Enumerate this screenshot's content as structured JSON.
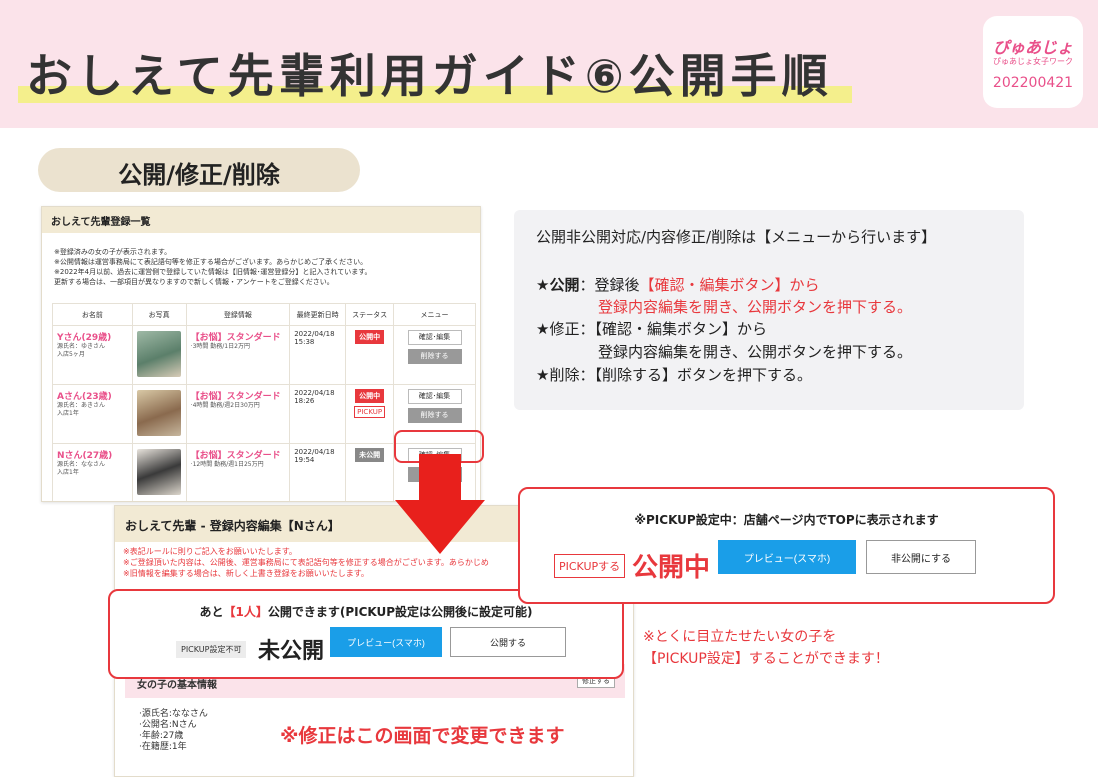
{
  "header": {
    "title": "おしえて先輩利用ガイド⑥公開手順",
    "logo_text": "ぴゅあじょ",
    "logo_sub": "ぴゅあじょ女子ワーク",
    "logo_date": "202200421"
  },
  "section_pill": "公開/修正/削除",
  "list_panel": {
    "title": "おしえて先輩登録一覧",
    "notes": [
      "※登録済みの女の子が表示されます。",
      "※公開情報は運営事務局にて表記語句等を修正する場合がございます。あらかじめご了承ください。",
      "※2022年4月以前、過去に運営側で登録していた情報は【旧情報･運営登録分】と記入されています。",
      "更新する場合は、一部項目が異なりますので新しく情報・アンケートをご登録ください。"
    ],
    "columns": [
      "お名前",
      "お写真",
      "登録情報",
      "最終更新日時",
      "ステータス",
      "メニュー"
    ],
    "rows": [
      {
        "name": "Yさん(29歳)",
        "genji": "源氏名：ゆきさん",
        "tenure": "入店5ヶ月",
        "plan": "【お悩】スタンダード",
        "detail": "·3時間 勤務/1日2万円",
        "date": "2022/04/18",
        "time": "15:38",
        "status": "公開中",
        "pickup": "",
        "menu_edit": "確認･編集",
        "menu_delete": "削除する"
      },
      {
        "name": "Aさん(23歳)",
        "genji": "源氏名：あきさん",
        "tenure": "入店1年",
        "plan": "【お悩】スタンダード",
        "detail": "·4時間 勤務/週2日30万円",
        "date": "2022/04/18",
        "time": "18:26",
        "status": "公開中",
        "pickup": "PICKUP",
        "menu_edit": "確認･編集",
        "menu_delete": "削除する"
      },
      {
        "name": "Nさん(27歳)",
        "genji": "源氏名：ななさん",
        "tenure": "入店1年",
        "plan": "【お悩】スタンダード",
        "detail": "·12時間 勤務/週1日25万円",
        "date": "2022/04/18",
        "time": "19:54",
        "status": "未公開",
        "pickup": "",
        "menu_edit": "確認･編集",
        "menu_delete": ""
      }
    ]
  },
  "info_box": {
    "line1": "公開非公開対応/内容修正/削除は【メニューから行います】",
    "pub_label": "★公開",
    "pub_text1": "：登録後",
    "pub_text1_red": "【確認・編集ボタン】から",
    "pub_text2_red": "登録内容編集を開き、公開ボタンを押下する。",
    "fix_text1": "★修正：【確認・編集ボタン】から",
    "fix_text2": "登録内容編集を開き、公開ボタンを押下する。",
    "del_text": "★削除：【削除する】ボタンを押下する。"
  },
  "edit_panel": {
    "title": "おしえて先輩 - 登録内容編集【Nさん】",
    "notes": [
      "※表記ルールに則りご記入をお願いいたします。",
      "※ご登録頂いた内容は、公開後、運営事務局にて表記語句等を修正する場合がございます。あらかじめ",
      "※旧情報を編集する場合は、新しく上書き登録をお願いいたします。"
    ],
    "remain_prefix": "あと",
    "remain_count": "【1人】",
    "remain_suffix": "公開できます(PICKUP設定は公開後に設定可能)",
    "pickup_disabled": "PICKUP設定不可",
    "status": "未公開",
    "preview_button": "プレビュー(スマホ)",
    "publish_button": "公開する",
    "basic_info_title": "女の子の基本情報",
    "fix_button": "修正する",
    "profile": [
      "·源氏名:ななさん",
      "·公開名:Nさん",
      "·年齢:27歳",
      "·在籍歴:1年"
    ]
  },
  "pickup_frame": {
    "caption": "※PICKUP設定中：店舗ページ内でTOPに表示されます",
    "pickup_button": "PICKUPする",
    "status": "公開中",
    "preview_button": "プレビュー(スマホ)",
    "unpublish_button": "非公開にする"
  },
  "pick_note": [
    "※とくに目立たせたい女の子を",
    "【PICKUP設定】することができます！"
  ],
  "fix_note": "※修正はこの画面で変更できます",
  "colors": {
    "accent_pink": "#e9508a",
    "alert_red": "#e8383d",
    "preview_blue": "#1a9ee8",
    "header_bg": "#fbe3ea"
  }
}
